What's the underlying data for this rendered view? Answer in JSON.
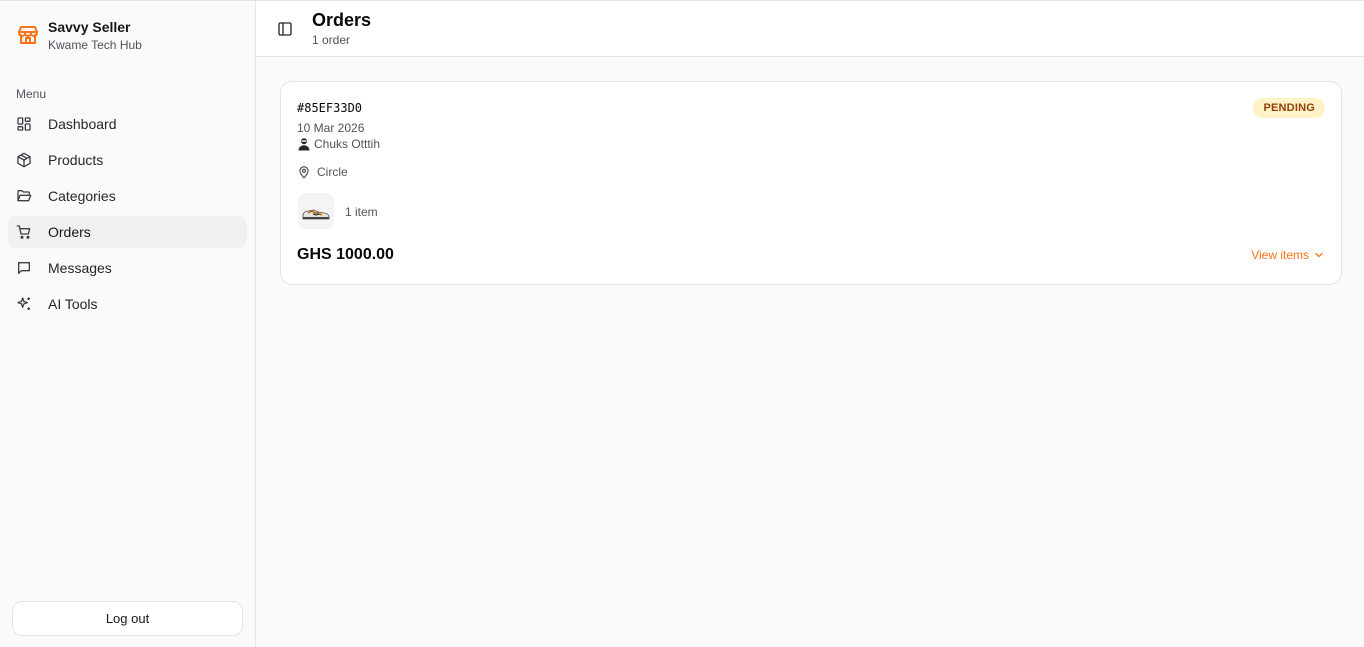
{
  "brand": {
    "name": "Savvy Seller",
    "store": "Kwame Tech Hub",
    "icon": "store-icon",
    "accent": "#f97316"
  },
  "sidebar": {
    "menu_label": "Menu",
    "items": [
      {
        "label": "Dashboard",
        "icon": "dashboard-icon",
        "active": false
      },
      {
        "label": "Products",
        "icon": "package-icon",
        "active": false
      },
      {
        "label": "Categories",
        "icon": "folder-icon",
        "active": false
      },
      {
        "label": "Orders",
        "icon": "cart-icon",
        "active": true
      },
      {
        "label": "Messages",
        "icon": "message-icon",
        "active": false
      },
      {
        "label": "AI Tools",
        "icon": "sparkles-icon",
        "active": false
      }
    ],
    "logout_label": "Log out"
  },
  "header": {
    "title": "Orders",
    "subtitle": "1 order"
  },
  "orders": [
    {
      "id": "#85EF33D0",
      "date": "10 Mar 2026",
      "customer": "Chuks Otttih",
      "location": "Circle",
      "item_count": "1 item",
      "total": "GHS 1000.00",
      "status": "PENDING",
      "status_bg": "#fef3c7",
      "status_fg": "#92400e",
      "view_items_label": "View items"
    }
  ]
}
